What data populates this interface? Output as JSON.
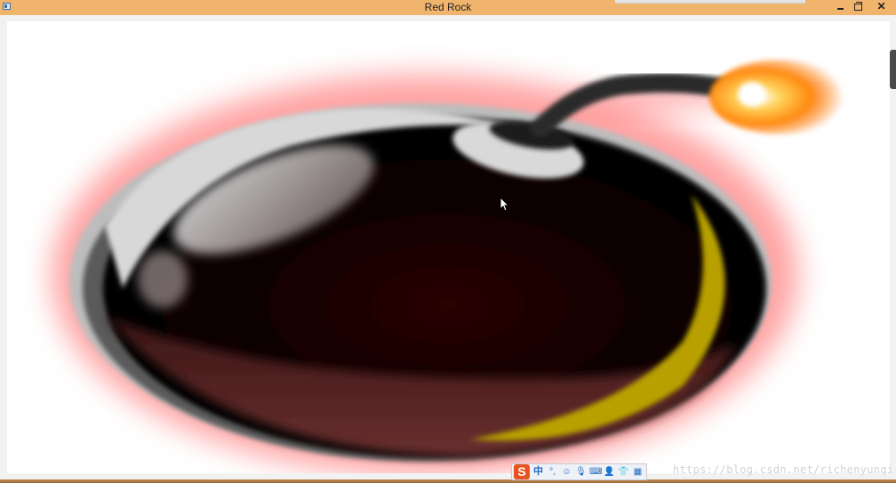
{
  "window": {
    "title": "Red Rock",
    "icons": [
      "app-icon",
      "minimize-icon",
      "maximize-icon",
      "close-icon"
    ],
    "close_glyph": "✕"
  },
  "canvas": {
    "content": "bomb-image",
    "colors": {
      "background": "#ffffff",
      "glow": "#ff7a7a",
      "bomb_body": "#0a0000",
      "bomb_lower": "#5a2525",
      "crescent": "#b8a007",
      "metal": "#cfcfcf",
      "fuse": "#2b2b2b",
      "spark": "#ff9a1a"
    }
  },
  "ime_toolbar": {
    "logo": "S",
    "items": [
      {
        "name": "chinese-mode-icon",
        "glyph": "中"
      },
      {
        "name": "punctuation-icon",
        "glyph": "°,"
      },
      {
        "name": "emoji-icon",
        "glyph": "☺"
      },
      {
        "name": "microphone-icon",
        "glyph": "🎙"
      },
      {
        "name": "keyboard-icon",
        "glyph": "⌨"
      },
      {
        "name": "user-icon",
        "glyph": "👤"
      },
      {
        "name": "skin-icon",
        "glyph": "👕"
      },
      {
        "name": "grid-icon",
        "glyph": "▦"
      }
    ]
  },
  "watermark": "https://blog.csdn.net/richenyunqi"
}
